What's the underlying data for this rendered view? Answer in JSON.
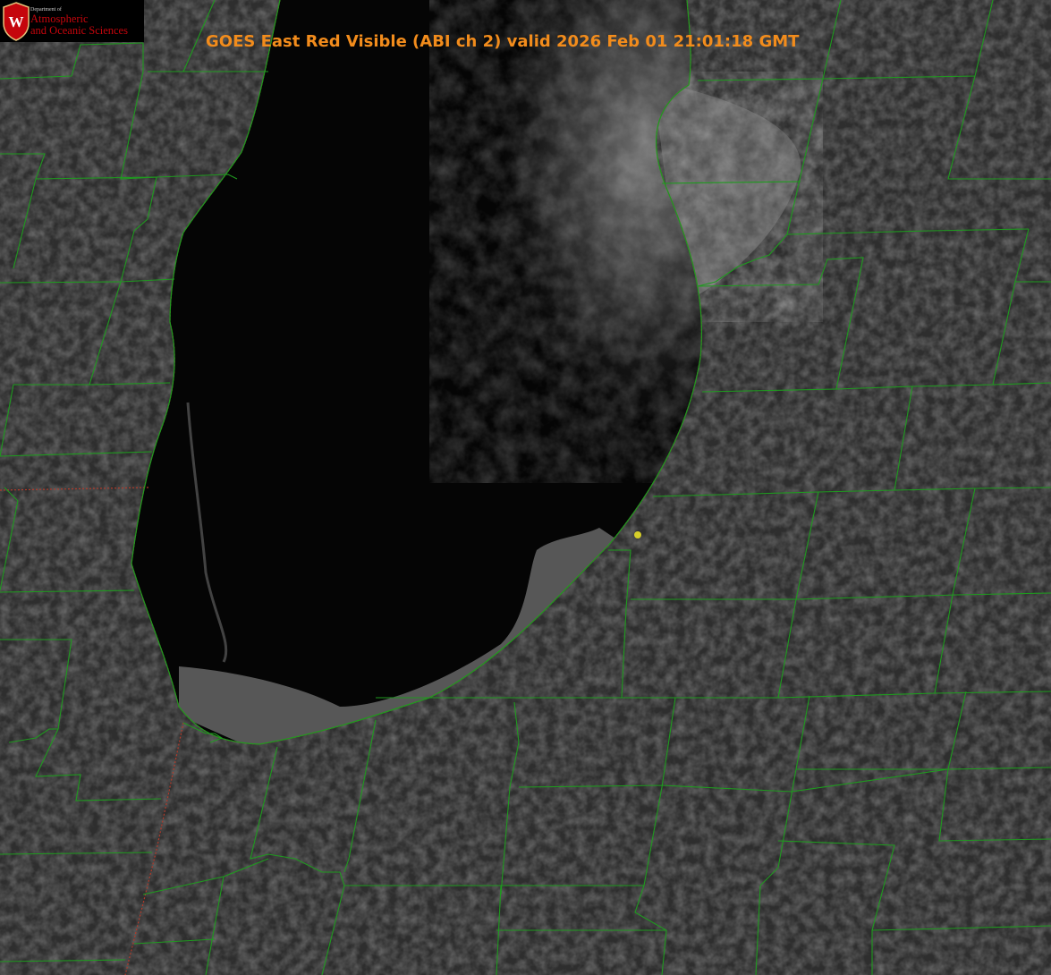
{
  "title": "GOES East Red Visible (ABI ch 2) valid 2026 Feb 01 21:01:18 GMT",
  "logo": {
    "badge_letter": "W",
    "department": "Department of",
    "line1": "Atmospheric",
    "line2": "and Oceanic Sciences"
  },
  "colors": {
    "title": "#f28c1c",
    "county_lines": "#1f9a1f",
    "state_lines": "#b33a2a",
    "lake": "#050505",
    "land": "#2e2e2e",
    "marker": "#d6cf2a",
    "logo_red": "#c5050c"
  },
  "icons": [
    "uw-crest-icon",
    "station-marker-icon"
  ]
}
